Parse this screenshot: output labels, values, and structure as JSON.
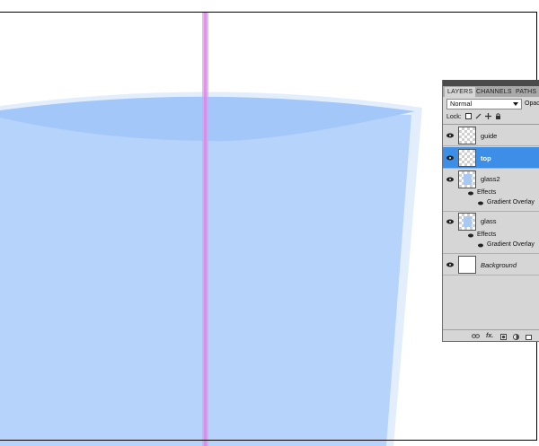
{
  "canvas": {
    "glass_color": "#b6d3fb",
    "rim_color": "#e3eefc",
    "water_top_color": "#a3c7f8",
    "guide_color": "#e79bf2"
  },
  "layers_panel": {
    "tabs": [
      {
        "label": "LAYERS",
        "active": true
      },
      {
        "label": "CHANNELS",
        "active": false
      },
      {
        "label": "PATHS",
        "active": false
      }
    ],
    "blend_mode": "Normal",
    "opacity_label": "Opac",
    "lock_label": "Lock:",
    "layers": [
      {
        "name": "guide",
        "selected": false,
        "thumb": "transparent"
      },
      {
        "name": "top",
        "selected": true,
        "thumb": "transparent"
      },
      {
        "name": "glass2",
        "selected": false,
        "thumb": "glass",
        "effects_label": "Effects",
        "effect": "Gradient Overlay"
      },
      {
        "name": "glass",
        "selected": false,
        "thumb": "glass",
        "effects_label": "Effects",
        "effect": "Gradient Overlay"
      },
      {
        "name": "Background",
        "selected": false,
        "thumb": "white",
        "italic": true
      }
    ],
    "bottom_icons": [
      "link-icon",
      "fx-icon",
      "mask-icon",
      "adjustment-icon",
      "new-layer-icon"
    ],
    "fx_label": "fx."
  }
}
